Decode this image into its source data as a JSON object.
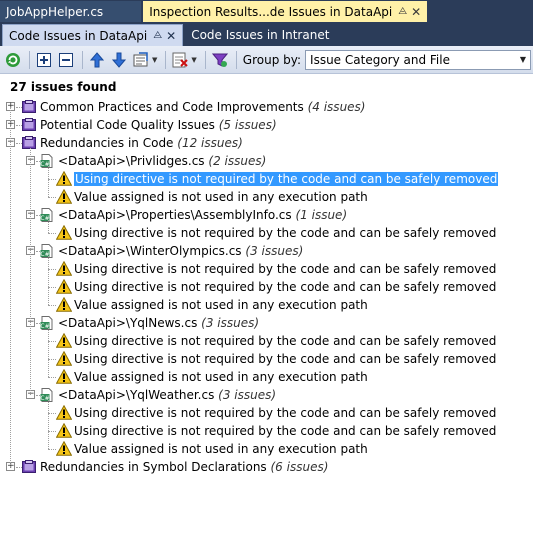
{
  "doc_tabs": [
    {
      "label": "JobAppHelper.cs",
      "active": false
    },
    {
      "label": "Inspection Results...de Issues in DataApi",
      "active": true
    }
  ],
  "tool_tabs": [
    {
      "label": "Code Issues in DataApi",
      "active": true
    },
    {
      "label": "Code Issues in Intranet",
      "active": false
    }
  ],
  "toolbar": {
    "group_by_label": "Group by:",
    "group_by_value": "Issue Category and File",
    "icons": [
      "refresh-icon",
      "expand-all-icon",
      "collapse-all-icon",
      "previous-icon",
      "next-icon",
      "export-icon",
      "filter-settings-icon",
      "filter-icon"
    ]
  },
  "summary": {
    "count_text": "27 issues found"
  },
  "colors": {
    "tab_strip": "#2b3c59",
    "active_doc_tab": "#fff1a8",
    "selection": "#3399ff",
    "warning": "#f5c518"
  },
  "tree": {
    "categories": [
      {
        "label": "Common Practices and Code Improvements",
        "count": "(4 issues)",
        "expanded": false
      },
      {
        "label": "Potential Code Quality Issues",
        "count": "(5 issues)",
        "expanded": false
      },
      {
        "label": "Redundancies in Code",
        "count": "(12 issues)",
        "expanded": true,
        "files": [
          {
            "label": "<DataApi>\\Privlidges.cs",
            "count": "(2 issues)",
            "issues": [
              "Using directive is not required by the code and can be safely removed",
              "Value assigned is not used in any execution path"
            ]
          },
          {
            "label": "<DataApi>\\Properties\\AssemblyInfo.cs",
            "count": "(1 issue)",
            "issues": [
              "Using directive is not required by the code and can be safely removed"
            ]
          },
          {
            "label": "<DataApi>\\WinterOlympics.cs",
            "count": "(3 issues)",
            "issues": [
              "Using directive is not required by the code and can be safely removed",
              "Using directive is not required by the code and can be safely removed",
              "Value assigned is not used in any execution path"
            ]
          },
          {
            "label": "<DataApi>\\YqlNews.cs",
            "count": "(3 issues)",
            "issues": [
              "Using directive is not required by the code and can be safely removed",
              "Using directive is not required by the code and can be safely removed",
              "Value assigned is not used in any execution path"
            ]
          },
          {
            "label": "<DataApi>\\YqlWeather.cs",
            "count": "(3 issues)",
            "issues": [
              "Using directive is not required by the code and can be safely removed",
              "Using directive is not required by the code and can be safely removed",
              "Value assigned is not used in any execution path"
            ]
          }
        ]
      },
      {
        "label": "Redundancies in Symbol Declarations",
        "count": "(6 issues)",
        "expanded": false
      }
    ]
  }
}
